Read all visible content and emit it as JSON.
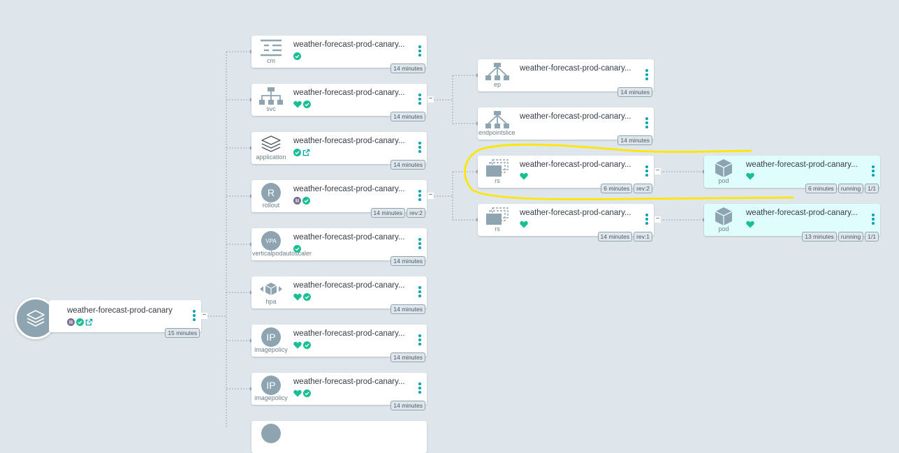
{
  "root": {
    "title": "weather-forecast-prod-canary",
    "age": "15 minutes",
    "status": [
      "paused",
      "synced",
      "external-link"
    ]
  },
  "column1": [
    {
      "kind": "cm",
      "icon": "configmap-icon",
      "title": "weather-forecast-prod-canary...",
      "status": [
        "synced"
      ],
      "tags": [
        "14 minutes"
      ]
    },
    {
      "kind": "svc",
      "icon": "service-icon",
      "title": "weather-forecast-prod-canary...",
      "status": [
        "healthy",
        "synced"
      ],
      "tags": [
        "14 minutes"
      ]
    },
    {
      "kind": "application",
      "icon": "application-icon",
      "title": "weather-forecast-prod-canary...",
      "status": [
        "synced",
        "external-link"
      ],
      "tags": [
        "14 minutes"
      ]
    },
    {
      "kind": "rollout",
      "icon": "rollout-icon",
      "glyph": "R",
      "title": "weather-forecast-prod-canary...",
      "status": [
        "paused",
        "synced"
      ],
      "tags": [
        "14 minutes",
        "rev:2"
      ]
    },
    {
      "kind": "verticalpodautoscaler",
      "icon": "vpa-icon",
      "glyph": "VPA",
      "title": "weather-forecast-prod-canary...",
      "status": [
        "synced"
      ],
      "tags": [
        "14 minutes"
      ]
    },
    {
      "kind": "hpa",
      "icon": "hpa-icon",
      "title": "weather-forecast-prod-canary...",
      "status": [
        "healthy",
        "synced"
      ],
      "tags": [
        "14 minutes"
      ]
    },
    {
      "kind": "imagepolicy",
      "icon": "imagepolicy-icon",
      "glyph": "IP",
      "title": "weather-forecast-prod-canary...",
      "status": [
        "healthy",
        "synced"
      ],
      "tags": [
        "14 minutes"
      ]
    },
    {
      "kind": "imagepolicy",
      "icon": "imagepolicy-icon",
      "glyph": "IP",
      "title": "weather-forecast-prod-canary...",
      "status": [
        "healthy",
        "synced"
      ],
      "tags": [
        "14 minutes"
      ]
    }
  ],
  "column2": [
    {
      "kind": "ep",
      "icon": "endpoints-icon",
      "title": "weather-forecast-prod-canary...",
      "status": [],
      "tags": [
        "14 minutes"
      ]
    },
    {
      "kind": "endpointslice",
      "icon": "endpointslice-icon",
      "title": "weather-forecast-prod-canary...",
      "status": [],
      "tags": [
        "14 minutes"
      ]
    },
    {
      "kind": "rs",
      "icon": "replicaset-icon",
      "title": "weather-forecast-prod-canary...",
      "status": [
        "healthy"
      ],
      "tags": [
        "6 minutes",
        "rev:2"
      ]
    },
    {
      "kind": "rs",
      "icon": "replicaset-icon",
      "title": "weather-forecast-prod-canary...",
      "status": [
        "healthy"
      ],
      "tags": [
        "14 minutes",
        "rev:1"
      ]
    }
  ],
  "column3": [
    {
      "kind": "pod",
      "icon": "pod-icon",
      "title": "weather-forecast-prod-canary...",
      "status": [
        "healthy"
      ],
      "tags": [
        "6 minutes",
        "running",
        "1/1"
      ]
    },
    {
      "kind": "pod",
      "icon": "pod-icon",
      "title": "weather-forecast-prod-canary...",
      "status": [
        "healthy"
      ],
      "tags": [
        "13 minutes",
        "running",
        "1/1"
      ]
    }
  ],
  "colors": {
    "background": "#dee6eb",
    "healthy": "#18be94",
    "synced": "#18be94",
    "paused": "#766f94",
    "accent": "#00a2b3",
    "icon": "#8fa4b1",
    "pod_bg": "#e0fdfd",
    "highlight": "#ffe600"
  }
}
